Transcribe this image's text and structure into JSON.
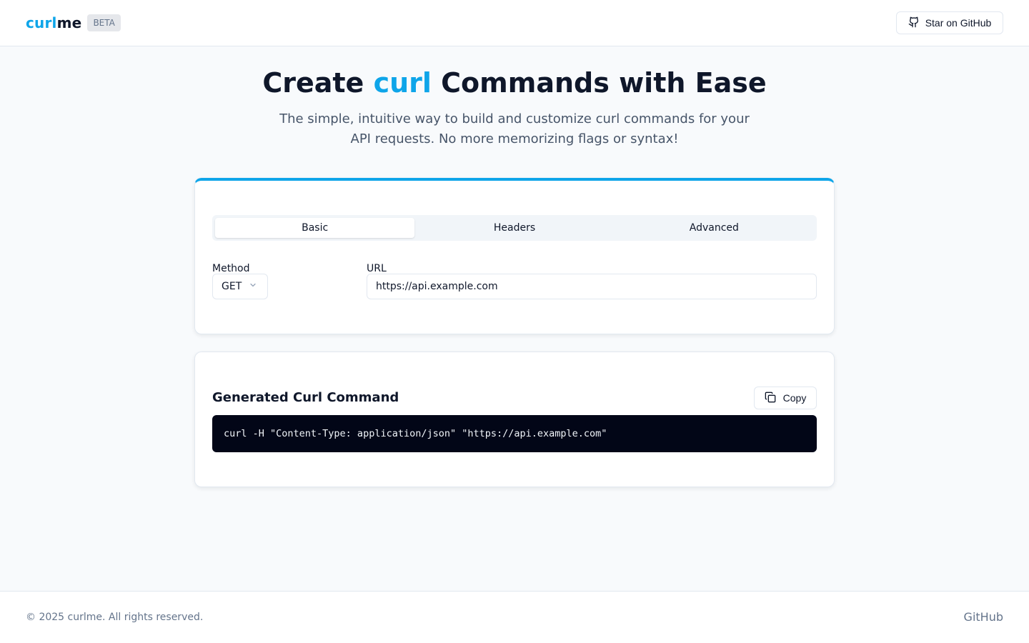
{
  "header": {
    "brand_accent": "curl",
    "brand_rest": "me",
    "badge": "BETA",
    "github_button": "Star on GitHub"
  },
  "hero": {
    "title_pre": "Create ",
    "title_accent": "curl",
    "title_post": " Commands with Ease",
    "subtitle": "The simple, intuitive way to build and customize curl commands for your API requests. No more memorizing flags or syntax!"
  },
  "form": {
    "tabs": [
      {
        "label": "Basic",
        "active": true
      },
      {
        "label": "Headers",
        "active": false
      },
      {
        "label": "Advanced",
        "active": false
      }
    ],
    "method_label": "Method",
    "method_value": "GET",
    "url_label": "URL",
    "url_value": "https://api.example.com"
  },
  "output": {
    "title": "Generated Curl Command",
    "copy_label": "Copy",
    "command": "curl -H \"Content-Type: application/json\" \"https://api.example.com\""
  },
  "footer": {
    "copyright": "© 2025 curlme. All rights reserved.",
    "link": "GitHub"
  },
  "colors": {
    "accent": "#0ea5e9",
    "code_bg": "#020617",
    "text": "#0f172a",
    "muted": "#64748b"
  },
  "icons": {
    "github": "github-icon",
    "chevron": "chevron-down-icon",
    "copy": "copy-icon"
  }
}
